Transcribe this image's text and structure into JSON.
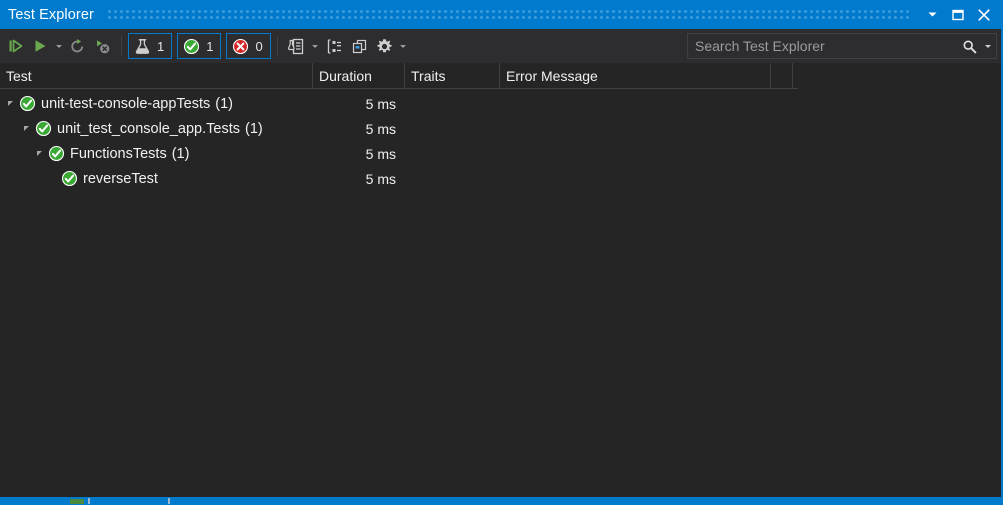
{
  "window": {
    "title": "Test Explorer",
    "controls": [
      {
        "name": "dropdown-icon",
        "label": "Window options"
      },
      {
        "name": "maximize-icon",
        "label": "Maximize"
      },
      {
        "name": "close-icon",
        "label": "Close"
      }
    ]
  },
  "toolbar": {
    "run_all_label": "Run All",
    "run_label": "Run",
    "run_caret_label": "Run options",
    "repeat_label": "Repeat Last Run",
    "stop_label": "Cancel Test Run",
    "playlist_label": "Playlist",
    "playlist_caret_label": "Playlist options",
    "group_by_label": "Group By",
    "output_label": "Open Additional Output",
    "settings_label": "Settings",
    "settings_caret_label": "Settings options",
    "filters": [
      {
        "name": "filter-total",
        "icon": "flask-icon",
        "count": "1"
      },
      {
        "name": "filter-passed",
        "icon": "check-circle-icon",
        "count": "1"
      },
      {
        "name": "filter-failed",
        "icon": "error-circle-icon",
        "count": "0"
      }
    ]
  },
  "search": {
    "placeholder": "Search Test Explorer",
    "value": ""
  },
  "columns": [
    {
      "key": "test",
      "label": "Test"
    },
    {
      "key": "duration",
      "label": "Duration"
    },
    {
      "key": "traits",
      "label": "Traits"
    },
    {
      "key": "error",
      "label": "Error Message"
    }
  ],
  "tree": {
    "rows": [
      {
        "level": 0,
        "expandable": true,
        "expanded": true,
        "status": "passed",
        "label": "unit-test-console-appTests",
        "count": "(1)",
        "duration": "5 ms",
        "traits": "",
        "error": ""
      },
      {
        "level": 1,
        "expandable": true,
        "expanded": true,
        "status": "passed",
        "label": "unit_test_console_app.Tests",
        "count": "(1)",
        "duration": "5 ms",
        "traits": "",
        "error": ""
      },
      {
        "level": 2,
        "expandable": true,
        "expanded": true,
        "status": "passed",
        "label": "FunctionsTests",
        "count": "(1)",
        "duration": "5 ms",
        "traits": "",
        "error": ""
      },
      {
        "level": 3,
        "expandable": false,
        "expanded": false,
        "status": "passed",
        "label": "reverseTest",
        "count": "",
        "duration": "5 ms",
        "traits": "",
        "error": ""
      }
    ]
  },
  "colors": {
    "accent": "#007acc",
    "pass_green": "#3aa835",
    "fail_red": "#d62728",
    "toolbar_bg": "#2d2d30",
    "panel_bg": "#252526",
    "text": "#f0f0f0"
  }
}
